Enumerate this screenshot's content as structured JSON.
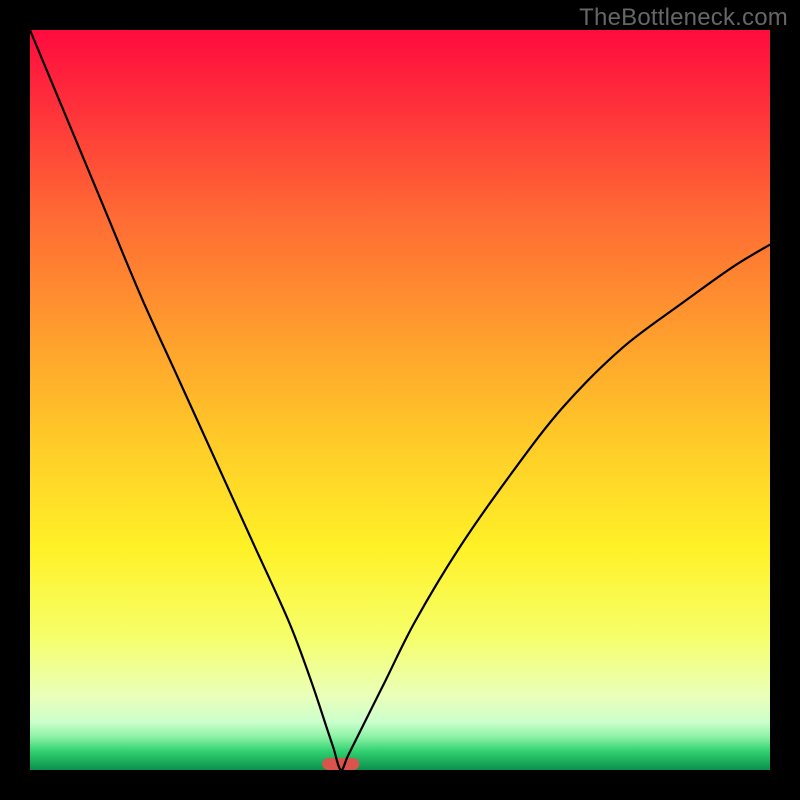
{
  "watermark": "TheBottleneck.com",
  "chart_data": {
    "type": "line",
    "title": "",
    "xlabel": "",
    "ylabel": "",
    "xlim": [
      0,
      100
    ],
    "ylim": [
      0,
      100
    ],
    "grid": false,
    "legend": false,
    "curve": {
      "minimum_x": 42,
      "series": [
        {
          "x": 0,
          "y": 100
        },
        {
          "x": 5,
          "y": 88
        },
        {
          "x": 10,
          "y": 76
        },
        {
          "x": 15,
          "y": 64
        },
        {
          "x": 20,
          "y": 53
        },
        {
          "x": 25,
          "y": 42
        },
        {
          "x": 30,
          "y": 31
        },
        {
          "x": 35,
          "y": 20
        },
        {
          "x": 38,
          "y": 12
        },
        {
          "x": 40,
          "y": 6
        },
        {
          "x": 41,
          "y": 3
        },
        {
          "x": 42,
          "y": 0
        },
        {
          "x": 43,
          "y": 2
        },
        {
          "x": 45,
          "y": 6
        },
        {
          "x": 48,
          "y": 12
        },
        {
          "x": 52,
          "y": 20
        },
        {
          "x": 58,
          "y": 30
        },
        {
          "x": 65,
          "y": 40
        },
        {
          "x": 72,
          "y": 49
        },
        {
          "x": 80,
          "y": 57
        },
        {
          "x": 88,
          "y": 63
        },
        {
          "x": 95,
          "y": 68
        },
        {
          "x": 100,
          "y": 71
        }
      ]
    },
    "marker": {
      "x": 42,
      "y": 0,
      "width_pct": 5,
      "color": "#d9544d"
    },
    "background_gradient": {
      "stops": [
        {
          "offset": 0.0,
          "color": "#ff0b3e"
        },
        {
          "offset": 0.1,
          "color": "#ff2f3b"
        },
        {
          "offset": 0.25,
          "color": "#ff6a34"
        },
        {
          "offset": 0.4,
          "color": "#ff9a2e"
        },
        {
          "offset": 0.55,
          "color": "#ffc928"
        },
        {
          "offset": 0.7,
          "color": "#fff127"
        },
        {
          "offset": 0.82,
          "color": "#f6ff6a"
        },
        {
          "offset": 0.9,
          "color": "#eaffba"
        },
        {
          "offset": 0.935,
          "color": "#ccffcc"
        },
        {
          "offset": 0.955,
          "color": "#8df2a5"
        },
        {
          "offset": 0.975,
          "color": "#30d070"
        },
        {
          "offset": 1.0,
          "color": "#0a8f4a"
        }
      ]
    }
  }
}
